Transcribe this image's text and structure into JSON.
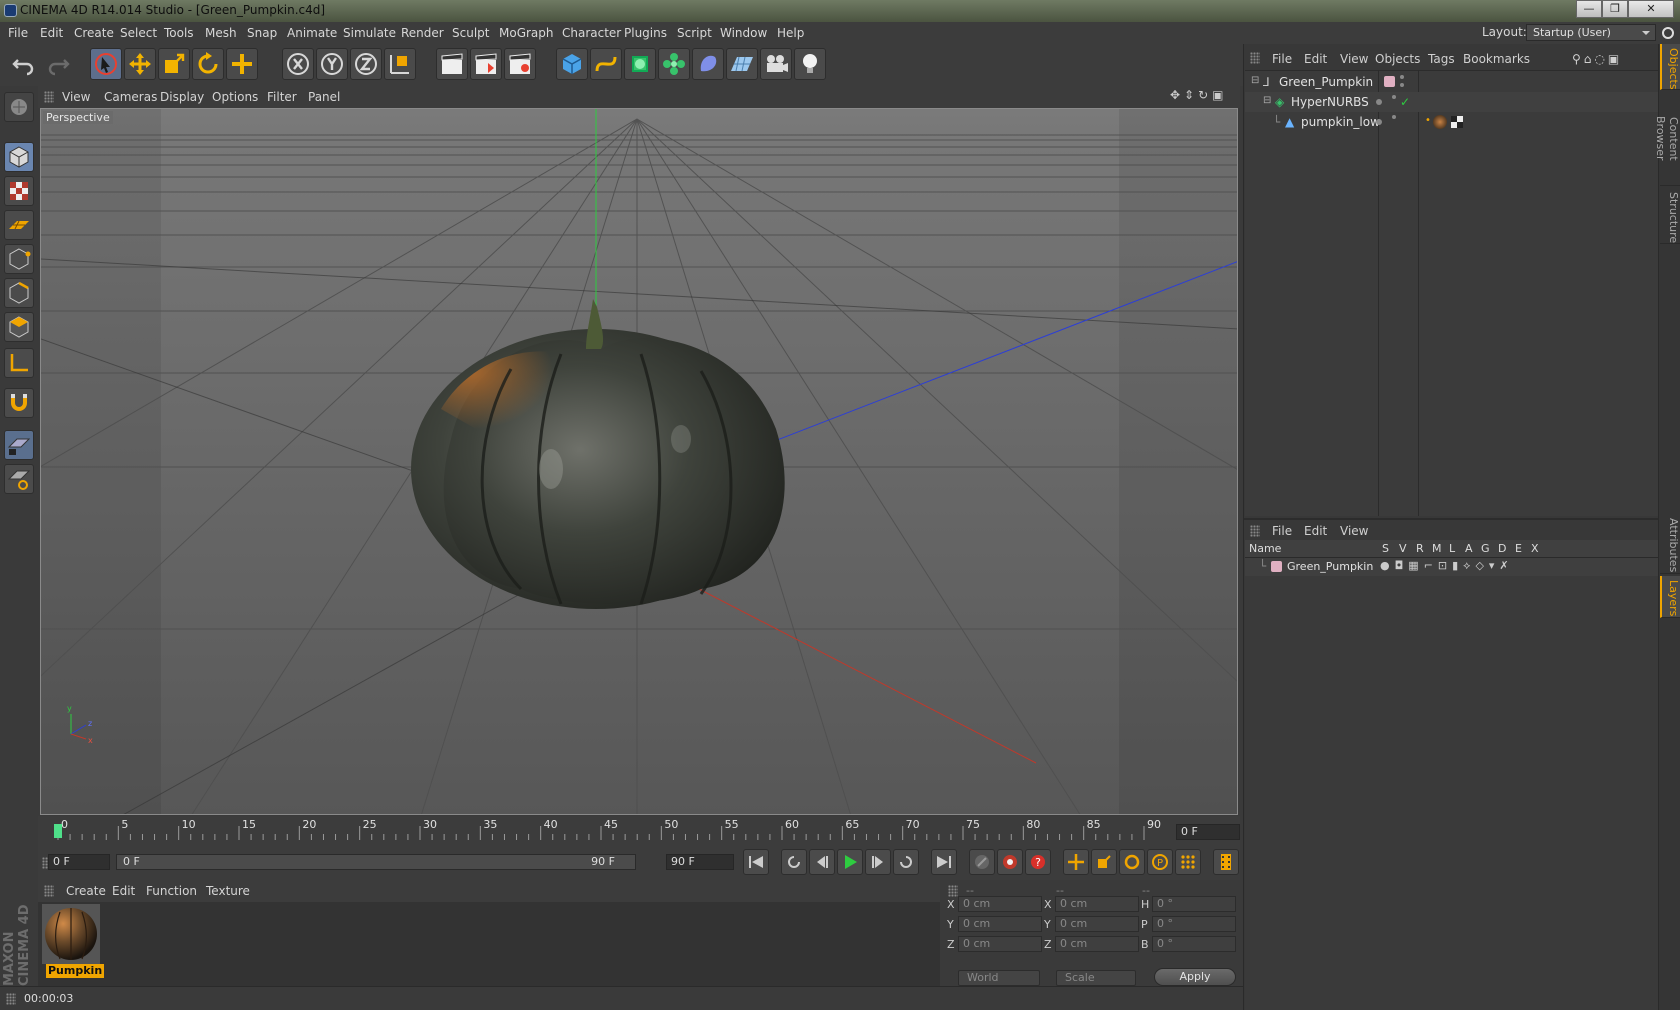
{
  "window": {
    "title": "CINEMA 4D R14.014 Studio - [Green_Pumpkin.c4d]",
    "minimize": "—",
    "restore": "❐",
    "close": "✕"
  },
  "menu": [
    "File",
    "Edit",
    "Create",
    "Select",
    "Tools",
    "Mesh",
    "Snap",
    "Animate",
    "Simulate",
    "Render",
    "Sculpt",
    "MoGraph",
    "Character",
    "Plugins",
    "Script",
    "Window",
    "Help"
  ],
  "layout": {
    "label": "Layout:",
    "value": "Startup (User)"
  },
  "viewport": {
    "menu": [
      "View",
      "Cameras",
      "Display",
      "Options",
      "Filter",
      "Panel"
    ],
    "label": "Perspective"
  },
  "timeline": {
    "ticks": [
      "0",
      "5",
      "10",
      "15",
      "20",
      "25",
      "30",
      "35",
      "40",
      "45",
      "50",
      "55",
      "60",
      "65",
      "70",
      "75",
      "80",
      "85",
      "90"
    ],
    "current_frame": "0 F",
    "start_field": "0 F",
    "slider_start": "0 F",
    "slider_end": "90 F",
    "end_field": "90 F"
  },
  "material_manager": {
    "menu": [
      "Create",
      "Edit",
      "Function",
      "Texture"
    ],
    "materials": [
      {
        "name": "Pumpkin"
      }
    ]
  },
  "coordinates": {
    "headers": [
      "--",
      "--",
      "--"
    ],
    "rows": [
      {
        "a": "X",
        "av": "0 cm",
        "b": "X",
        "bv": "0 cm",
        "c": "H",
        "cv": "0 °"
      },
      {
        "a": "Y",
        "av": "0 cm",
        "b": "Y",
        "bv": "0 cm",
        "c": "P",
        "cv": "0 °"
      },
      {
        "a": "Z",
        "av": "0 cm",
        "b": "Z",
        "bv": "0 cm",
        "c": "B",
        "cv": "0 °"
      }
    ],
    "space": "World",
    "mode": "Scale",
    "apply": "Apply"
  },
  "status": {
    "time": "00:00:03"
  },
  "object_manager": {
    "menu": [
      "File",
      "Edit",
      "View",
      "Objects",
      "Tags",
      "Bookmarks"
    ],
    "objects": [
      {
        "name": "Green_Pumpkin",
        "depth": 0
      },
      {
        "name": "HyperNURBS",
        "depth": 1
      },
      {
        "name": "pumpkin_low",
        "depth": 2
      }
    ]
  },
  "layer_manager": {
    "menu": [
      "File",
      "Edit",
      "View"
    ],
    "columns": [
      "Name",
      "S",
      "V",
      "R",
      "M",
      "L",
      "A",
      "G",
      "D",
      "E",
      "X"
    ],
    "layers": [
      {
        "name": "Green_Pumpkin",
        "color": "#e0b0c2"
      }
    ]
  },
  "side_tabs": [
    "Objects",
    "Content Browser",
    "Structure",
    "Attributes",
    "Layers"
  ],
  "colors": {
    "accent": "#f0a500",
    "axis_x": "#c0392b",
    "axis_y": "#2ecc40",
    "axis_z": "#2c3ed6"
  }
}
